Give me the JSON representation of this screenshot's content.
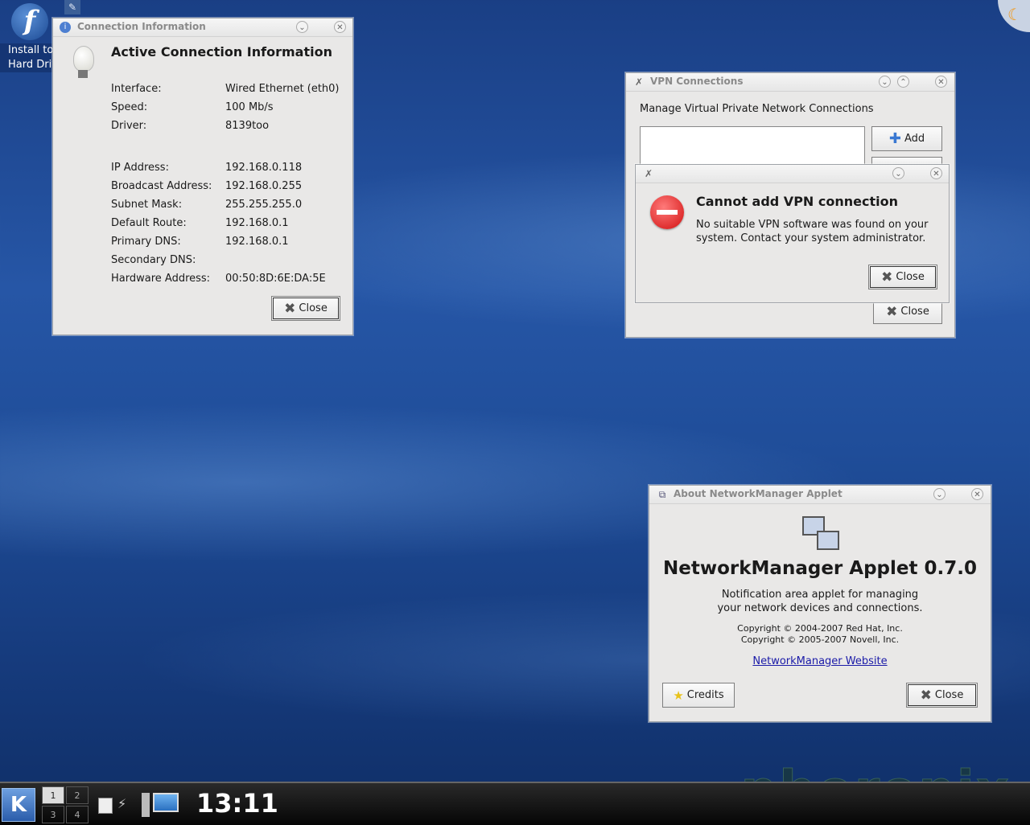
{
  "desktop": {
    "install_label_1": "Install to",
    "install_label_2": "Hard Drive",
    "fedora_icon": "fedora-logo-icon",
    "watermark": "phoronix"
  },
  "conn_info": {
    "title": "Connection Information",
    "heading": "Active Connection Information",
    "rows": [
      {
        "label": "Interface:",
        "value": "Wired Ethernet (eth0)"
      },
      {
        "label": "Speed:",
        "value": "100 Mb/s"
      },
      {
        "label": "Driver:",
        "value": "8139too"
      },
      {
        "label": "IP Address:",
        "value": "192.168.0.118"
      },
      {
        "label": "Broadcast Address:",
        "value": "192.168.0.255"
      },
      {
        "label": "Subnet Mask:",
        "value": "255.255.255.0"
      },
      {
        "label": "Default Route:",
        "value": "192.168.0.1"
      },
      {
        "label": "Primary DNS:",
        "value": "192.168.0.1"
      },
      {
        "label": "Secondary DNS:",
        "value": ""
      },
      {
        "label": "Hardware Address:",
        "value": "00:50:8D:6E:DA:5E"
      }
    ],
    "close_label": "Close"
  },
  "vpn": {
    "title": "VPN Connections",
    "subtitle": "Manage Virtual Private Network Connections",
    "add_label": "Add",
    "close_label": "Close"
  },
  "error": {
    "heading": "Cannot add VPN connection",
    "message_1": "No suitable VPN software was found on your",
    "message_2": "system. Contact your system administrator.",
    "close_label": "Close"
  },
  "about": {
    "title": "About NetworkManager Applet",
    "name": "NetworkManager Applet 0.7.0",
    "desc_1": "Notification area applet for managing",
    "desc_2": "your network devices and connections.",
    "copy_1": "Copyright © 2004-2007 Red Hat, Inc.",
    "copy_2": "Copyright © 2005-2007 Novell, Inc.",
    "link": "NetworkManager Website",
    "credits_label": "Credits",
    "close_label": "Close"
  },
  "taskbar": {
    "pager": [
      "1",
      "2",
      "3",
      "4"
    ],
    "clock": "13:11"
  }
}
